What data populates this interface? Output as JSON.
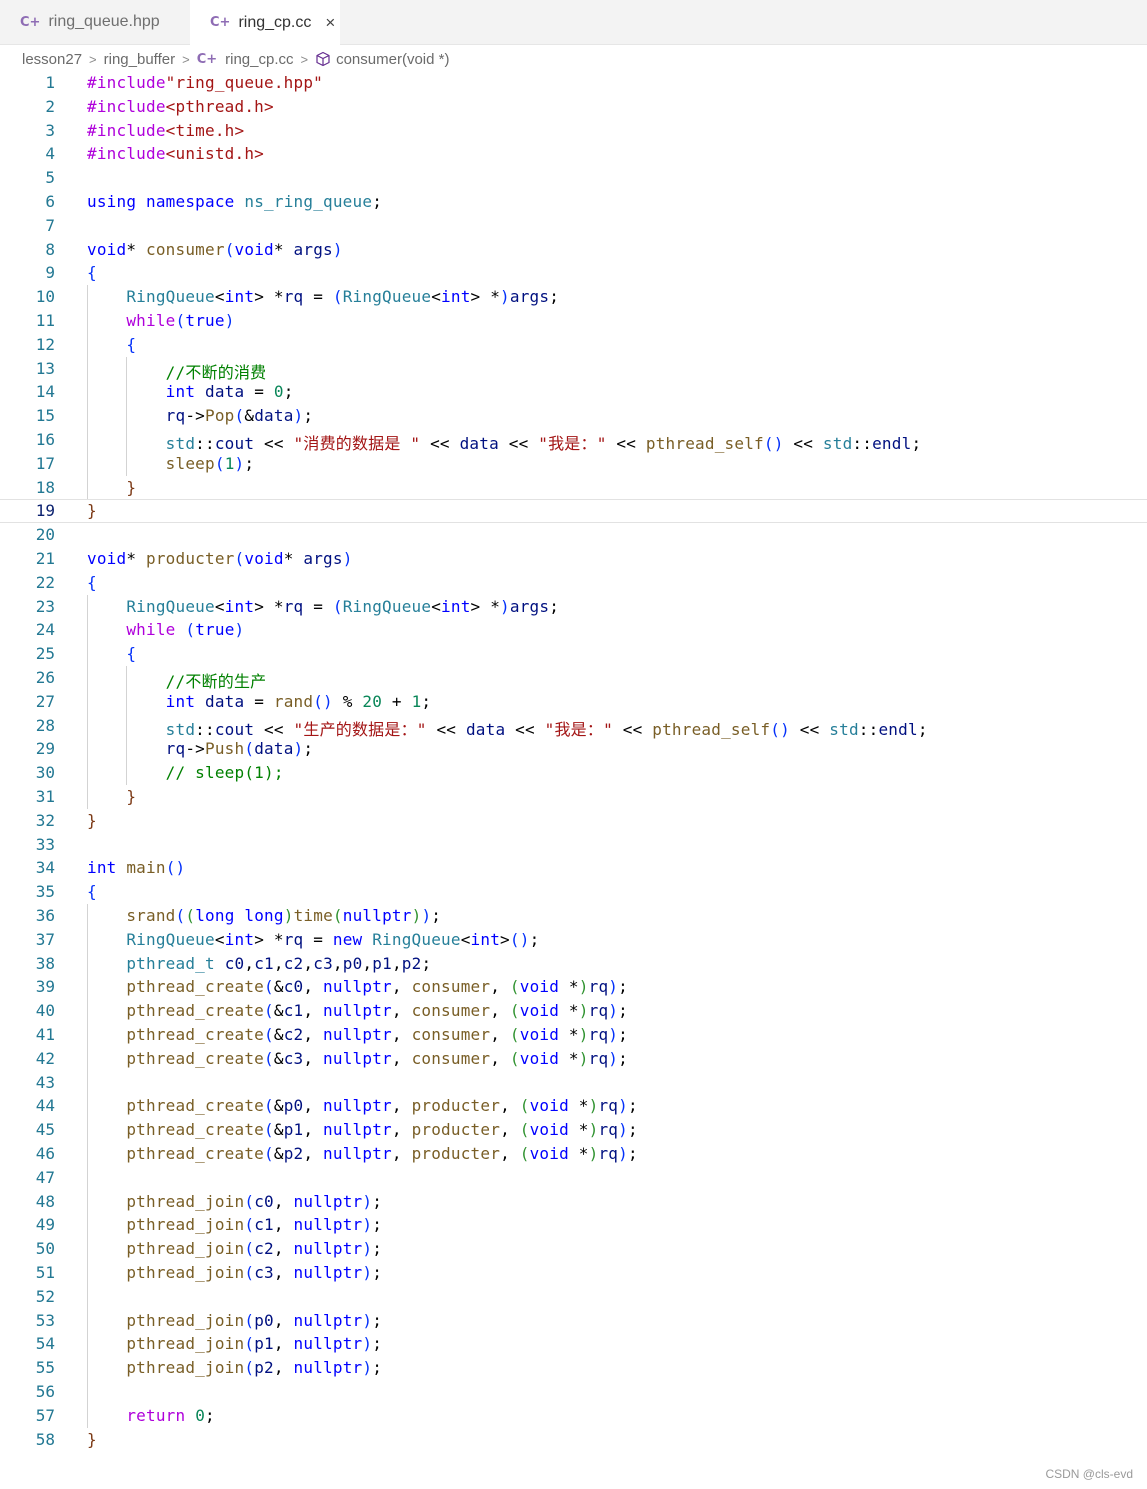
{
  "tabs": [
    {
      "label": "ring_queue.hpp",
      "icon": "cpp-file-icon",
      "active": false
    },
    {
      "label": "ring_cp.cc",
      "icon": "cpp-file-icon",
      "active": true,
      "close": "×"
    }
  ],
  "breadcrumb": {
    "items": [
      "lesson27",
      "ring_buffer",
      "ring_cp.cc",
      "consumer(void *)"
    ],
    "separator": ">"
  },
  "editor": {
    "active_line": 19,
    "lines": [
      "#include\"ring_queue.hpp\"",
      "#include<pthread.h>",
      "#include<time.h>",
      "#include<unistd.h>",
      "",
      "using namespace ns_ring_queue;",
      "",
      "void* consumer(void* args)",
      "{",
      "    RingQueue<int> *rq = (RingQueue<int> *)args;",
      "    while(true)",
      "    {",
      "        //不断的消费",
      "        int data = 0;",
      "        rq->Pop(&data);",
      "        std::cout << \"消费的数据是 \" << data << \"我是：\" << pthread_self() << std::endl;",
      "        sleep(1);",
      "    }",
      "}",
      "",
      "void* producter(void* args)",
      "{",
      "    RingQueue<int> *rq = (RingQueue<int> *)args;",
      "    while (true)",
      "    {",
      "        //不断的生产",
      "        int data = rand() % 20 + 1;",
      "        std::cout << \"生产的数据是：\" << data << \"我是：\" << pthread_self() << std::endl;",
      "        rq->Push(data);",
      "        // sleep(1);",
      "    }",
      "}",
      "",
      "int main()",
      "{",
      "    srand((long long)time(nullptr));",
      "    RingQueue<int> *rq = new RingQueue<int>();",
      "    pthread_t c0,c1,c2,c3,p0,p1,p2;",
      "    pthread_create(&c0, nullptr, consumer, (void *)rq);",
      "    pthread_create(&c1, nullptr, consumer, (void *)rq);",
      "    pthread_create(&c2, nullptr, consumer, (void *)rq);",
      "    pthread_create(&c3, nullptr, consumer, (void *)rq);",
      "",
      "    pthread_create(&p0, nullptr, producter, (void *)rq);",
      "    pthread_create(&p1, nullptr, producter, (void *)rq);",
      "    pthread_create(&p2, nullptr, producter, (void *)rq);",
      "",
      "    pthread_join(c0, nullptr);",
      "    pthread_join(c1, nullptr);",
      "    pthread_join(c2, nullptr);",
      "    pthread_join(c3, nullptr);",
      "",
      "    pthread_join(p0, nullptr);",
      "    pthread_join(p1, nullptr);",
      "    pthread_join(p2, nullptr);",
      "",
      "    return 0;",
      "}"
    ]
  },
  "watermark": "CSDN @cls-evd",
  "colors": {
    "keyword": "#0000ff",
    "control": "#af00db",
    "string": "#a31515",
    "function": "#795e26",
    "type": "#267f99",
    "variable": "#001080",
    "number": "#098658",
    "comment": "#008000",
    "line_number": "#237893"
  }
}
